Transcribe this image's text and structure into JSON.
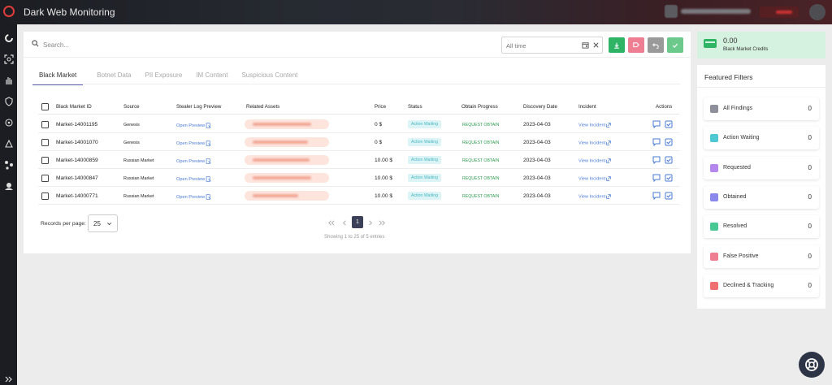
{
  "app": {
    "title": "Dark Web Monitoring"
  },
  "search": {
    "placeholder": "Search..."
  },
  "date_filter": {
    "value": "All time"
  },
  "colors": {
    "accent": "#5b5fb5",
    "download": "#2fb365",
    "flag": "#f07e92",
    "undo": "#9a9a9a",
    "approve": "#6ac98b"
  },
  "tabs": [
    {
      "label": "Black Market",
      "active": true
    },
    {
      "label": "Botnet Data"
    },
    {
      "label": "PII Exposure"
    },
    {
      "label": "IM Content"
    },
    {
      "label": "Suspicious Content"
    }
  ],
  "table": {
    "headers": {
      "id": "Black Market ID",
      "source": "Source",
      "preview": "Stealer Log Preview",
      "assets": "Related Assets",
      "price": "Price",
      "status": "Status",
      "progress": "Obtain Progress",
      "date": "Discovery Date",
      "incident": "Incident",
      "actions": "Actions"
    },
    "rows": [
      {
        "id": "Market-14001195",
        "source": "Genesis",
        "preview": "Open Preview",
        "price": "0 $",
        "status": "Action Waiting",
        "progress": "REQUEST OBTAIN",
        "date": "2023-04-03",
        "incident": "View Incident"
      },
      {
        "id": "Market-14001070",
        "source": "Genesis",
        "preview": "Open Preview",
        "price": "0 $",
        "status": "Action Waiting",
        "progress": "REQUEST OBTAIN",
        "date": "2023-04-03",
        "incident": "View Incident"
      },
      {
        "id": "Market-14000859",
        "source": "Russian Market",
        "preview": "Open Preview",
        "price": "10.00 $",
        "status": "Action Waiting",
        "progress": "REQUEST OBTAIN",
        "date": "2023-04-03",
        "incident": "View Incident"
      },
      {
        "id": "Market-14000847",
        "source": "Russian Market",
        "preview": "Open Preview",
        "price": "10.00 $",
        "status": "Action Waiting",
        "progress": "REQUEST OBTAIN",
        "date": "2023-04-03",
        "incident": "View Incident"
      },
      {
        "id": "Market-14000771",
        "source": "Russian Market",
        "preview": "Open Preview",
        "price": "10.00 $",
        "status": "Action Waiting",
        "progress": "REQUEST OBTAIN",
        "date": "2023-04-03",
        "incident": "View Incident"
      }
    ]
  },
  "pagination": {
    "records_label": "Records per page:",
    "per_page": "25",
    "current_page": "1",
    "info": "Showing 1 to 25 of 5 entries"
  },
  "credits": {
    "value": "0.00",
    "label": "Black Market Credits"
  },
  "featured_filters": {
    "title": "Featured Filters",
    "items": [
      {
        "label": "All Findings",
        "count": "0",
        "color": "#8f8f9c"
      },
      {
        "label": "Action Waiting",
        "count": "0",
        "color": "#4ec8d2"
      },
      {
        "label": "Requested",
        "count": "0",
        "color": "#b488ec"
      },
      {
        "label": "Obtained",
        "count": "0",
        "color": "#8b88ec"
      },
      {
        "label": "Resolved",
        "count": "0",
        "color": "#48c894"
      },
      {
        "label": "False Positive",
        "count": "0",
        "color": "#f07e92"
      },
      {
        "label": "Declined & Tracking",
        "count": "0",
        "color": "#ef7070"
      }
    ]
  }
}
